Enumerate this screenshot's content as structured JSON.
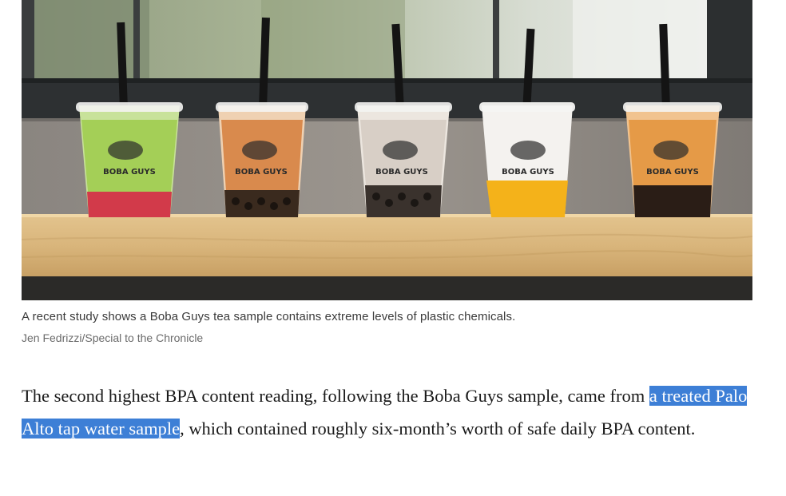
{
  "figure": {
    "image_alt": "Five Boba Guys cups of bubble tea with black straws lined up on a wooden ledge in front of a window",
    "cup_logo_text": "BOBA GUYS",
    "caption": "A recent study shows a Boba Guys tea sample contains extreme levels of plastic chemicals.",
    "credit": "Jen Fedrizzi/Special to the Chronicle"
  },
  "article": {
    "paragraph_before": "The second highest BPA content reading, following the Boba Guys sample, came from ",
    "selected_text": "a treated Palo Alto tap water sample",
    "paragraph_after": ", which contained roughly six-month’s worth of safe daily BPA content."
  },
  "colors": {
    "selection_highlight": "#3d7fd6",
    "body_text": "#1a1a1a",
    "caption_text": "#3a3a3a",
    "credit_text": "#6b6b6b"
  }
}
